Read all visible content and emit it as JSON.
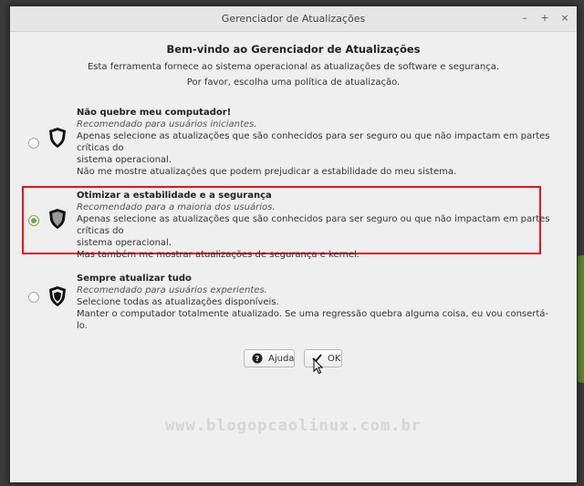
{
  "window": {
    "title": "Gerenciador de Atualizações",
    "controls": {
      "minimize": "–",
      "maximize": "+",
      "close": "×"
    }
  },
  "header": {
    "title": "Bem-vindo ao Gerenciador de Atualizações",
    "line1": "Esta ferramenta fornece ao sistema operacional as atualizações de software e segurança.",
    "line2": "Por favor, escolha uma política de atualização."
  },
  "options": [
    {
      "title": "Não quebre meu computador!",
      "recommend": "Recomendado para usuários iniciantes.",
      "desc1": "Apenas selecione as atualizações que são conhecidos para ser seguro ou que não impactam em partes críticas do",
      "desc2": "sistema operacional.",
      "desc3": "Não me mostre atualizações que podem prejudicar a estabilidade do meu sistema.",
      "selected": false
    },
    {
      "title": "Otimizar a estabilidade e a segurança",
      "recommend": "Recomendado para a maioria dos usuários.",
      "desc1": "Apenas selecione as atualizações que são conhecidos para ser seguro ou que não impactam em partes críticas do",
      "desc2": "sistema operacional.",
      "desc3": "Mas também me mostrar atualizações de segurança e kernel.",
      "selected": true
    },
    {
      "title": "Sempre atualizar tudo",
      "recommend": "Recomendado para usuários experientes.",
      "desc1": "Selecione todas as atualizações disponíveis.",
      "desc2": "Manter o computador totalmente atualizado. Se uma regressão quebra alguma coisa, eu vou consertá-lo.",
      "selected": false
    }
  ],
  "buttons": {
    "help": "Ajuda",
    "ok": "OK"
  },
  "watermark": "www.blogopcaolinux.com.br",
  "colors": {
    "highlight": "#e8121b",
    "radio_selected": "#7aa24a"
  }
}
